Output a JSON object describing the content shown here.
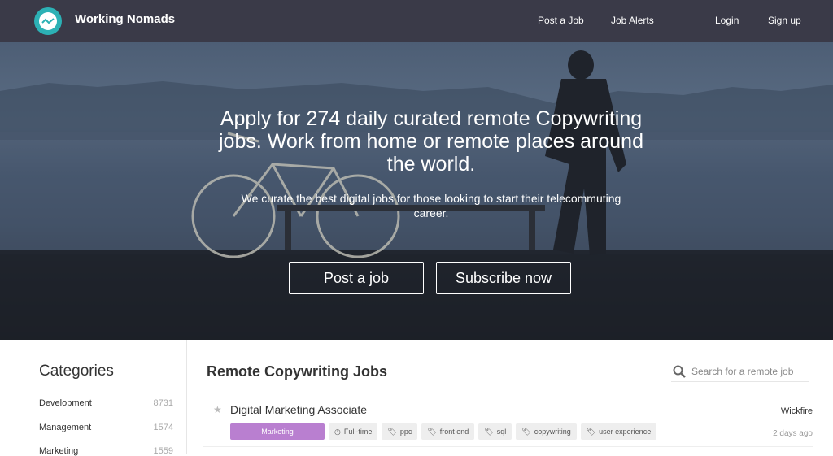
{
  "nav": {
    "brand": "Working Nomads",
    "links": [
      "Post a Job",
      "Job Alerts",
      "Login",
      "Sign up"
    ]
  },
  "hero": {
    "headline": "Apply for 274 daily curated remote Copywriting jobs. Work from home or remote places around the world.",
    "subline": "We curate the best digital jobs for those looking to start their telecommuting career.",
    "buttons": [
      "Post a job",
      "Subscribe now"
    ]
  },
  "sidebar": {
    "title": "Categories",
    "items": [
      {
        "label": "Development",
        "count": "8731"
      },
      {
        "label": "Management",
        "count": "1574"
      },
      {
        "label": "Marketing",
        "count": "1559"
      }
    ]
  },
  "main": {
    "title": "Remote Copywriting Jobs",
    "search_placeholder": "Search for a remote job",
    "jobs": [
      {
        "title": "Digital Marketing Associate",
        "company": "Wickfire",
        "date": "2 days ago",
        "category": "Marketing",
        "type": "Full-time",
        "tags": [
          "ppc",
          "front end",
          "sql",
          "copywriting",
          "user experience"
        ]
      }
    ]
  },
  "colors": {
    "nav_bg": "#3a3a48",
    "logo": "#2cb1b5",
    "category_badge": "#b97fd0"
  }
}
